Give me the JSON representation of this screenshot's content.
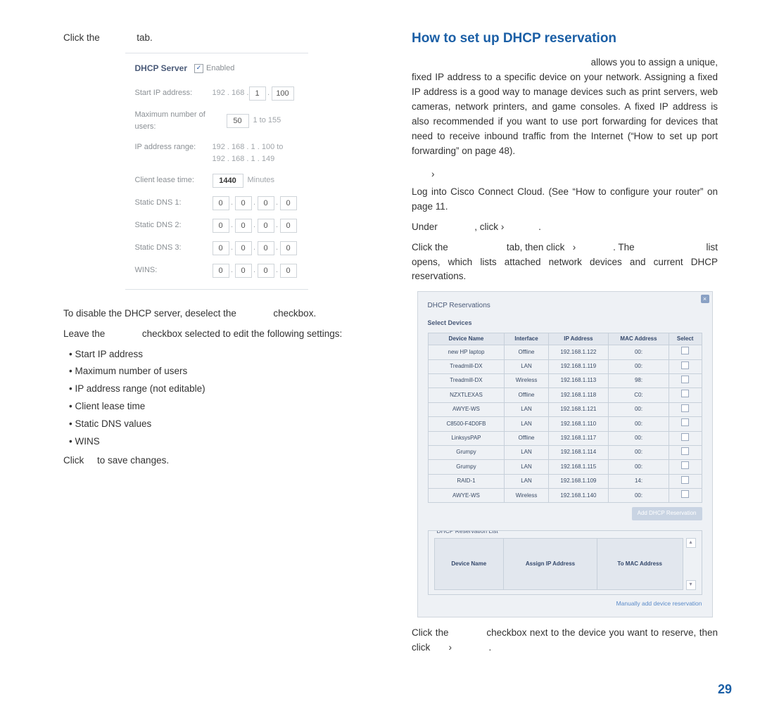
{
  "left": {
    "click_the": "Click the",
    "tab_word": "tab.",
    "dhcp_panel": {
      "title": "DHCP Server",
      "enabled_label": "Enabled",
      "rows": {
        "start_ip": {
          "label": "Start IP address:",
          "ip_gray": "192 . 168 .",
          "oct3": "1",
          "oct_dot": ".",
          "oct4": "100"
        },
        "max_users": {
          "label": "Maximum number of users:",
          "value": "50",
          "suffix": "1 to 155"
        },
        "range_label": "IP address range:",
        "range_line1": "192 . 168 . 1 . 100  to",
        "range_line2": "192 . 168 . 1 . 149",
        "lease": {
          "label": "Client lease time:",
          "value": "1440",
          "suffix": "Minutes"
        },
        "dns1": "Static DNS 1:",
        "dns2": "Static DNS 2:",
        "dns3": "Static DNS 3:",
        "wins": "WINS:",
        "zero": "0"
      }
    },
    "line1a": "To disable the DHCP server, deselect the",
    "line1b": "checkbox.",
    "line2a": "Leave the",
    "line2b": "checkbox selected to edit the following settings:",
    "bullets": [
      "Start IP address",
      "Maximum number of users",
      "IP address range (not editable)",
      "Client lease time",
      "Static DNS values",
      "WINS"
    ],
    "line3a": "Click",
    "line3b": "to save changes."
  },
  "right": {
    "heading": "How to set up DHCP reservation",
    "intro1": "allows you to assign a unique, fixed IP address to a specific device on your network. Assigning a fixed IP address is a good way to manage devices such as print servers, web cameras, network printers, and game consoles. A fixed IP address is also recommended if you want to use port forwarding for devices that need to receive inbound traffic from the Internet (“How to set up port forwarding” on page 48).",
    "step_arrow": "›",
    "step1": "Log into Cisco Connect Cloud. (See “How to configure your router” on page 11.",
    "step2a": "Under",
    "step2b": ", click",
    "step2c": "›",
    "step2d": ".",
    "step3a": "Click the",
    "step3b": "tab, then click",
    "step3c": "›",
    "step3d": ". The",
    "step3e": "list opens, which lists attached network devices and current DHCP reservations.",
    "dialog": {
      "title": "DHCP Reservations",
      "subtitle": "Select Devices",
      "headers": [
        "Device Name",
        "Interface",
        "IP Address",
        "MAC Address",
        "Select"
      ],
      "rows": [
        {
          "name": "new HP laptop",
          "iface": "Offline",
          "ip": "192.168.1.122",
          "mac": "00:"
        },
        {
          "name": "Treadmill-DX",
          "iface": "LAN",
          "ip": "192.168.1.119",
          "mac": "00:"
        },
        {
          "name": "Treadmill-DX",
          "iface": "Wireless",
          "ip": "192.168.1.113",
          "mac": "98:"
        },
        {
          "name": "NZXTLEXAS",
          "iface": "Offline",
          "ip": "192.168.1.118",
          "mac": "C0:"
        },
        {
          "name": "AWYE-WS",
          "iface": "LAN",
          "ip": "192.168.1.121",
          "mac": "00:"
        },
        {
          "name": "C8500-F4D0FB",
          "iface": "LAN",
          "ip": "192.168.1.110",
          "mac": "00:"
        },
        {
          "name": "LinksysPAP",
          "iface": "Offline",
          "ip": "192.168.1.117",
          "mac": "00:"
        },
        {
          "name": "Grumpy",
          "iface": "LAN",
          "ip": "192.168.1.114",
          "mac": "00:"
        },
        {
          "name": "Grumpy",
          "iface": "LAN",
          "ip": "192.168.1.115",
          "mac": "00:"
        },
        {
          "name": "RAID-1",
          "iface": "LAN",
          "ip": "192.168.1.109",
          "mac": "14:"
        },
        {
          "name": "AWYE-WS",
          "iface": "Wireless",
          "ip": "192.168.1.140",
          "mac": "00:"
        }
      ],
      "add_btn": "Add DHCP Reservation",
      "list_legend": "DHCP Reservation List",
      "list_headers": [
        "Device Name",
        "Assign IP Address",
        "To MAC Address"
      ],
      "manual_link": "Manually add device reservation"
    },
    "closing_a": "Click the",
    "closing_b": "checkbox next to the device you want to reserve, then click",
    "closing_c": "›",
    "closing_d": "."
  },
  "page_number": "29"
}
